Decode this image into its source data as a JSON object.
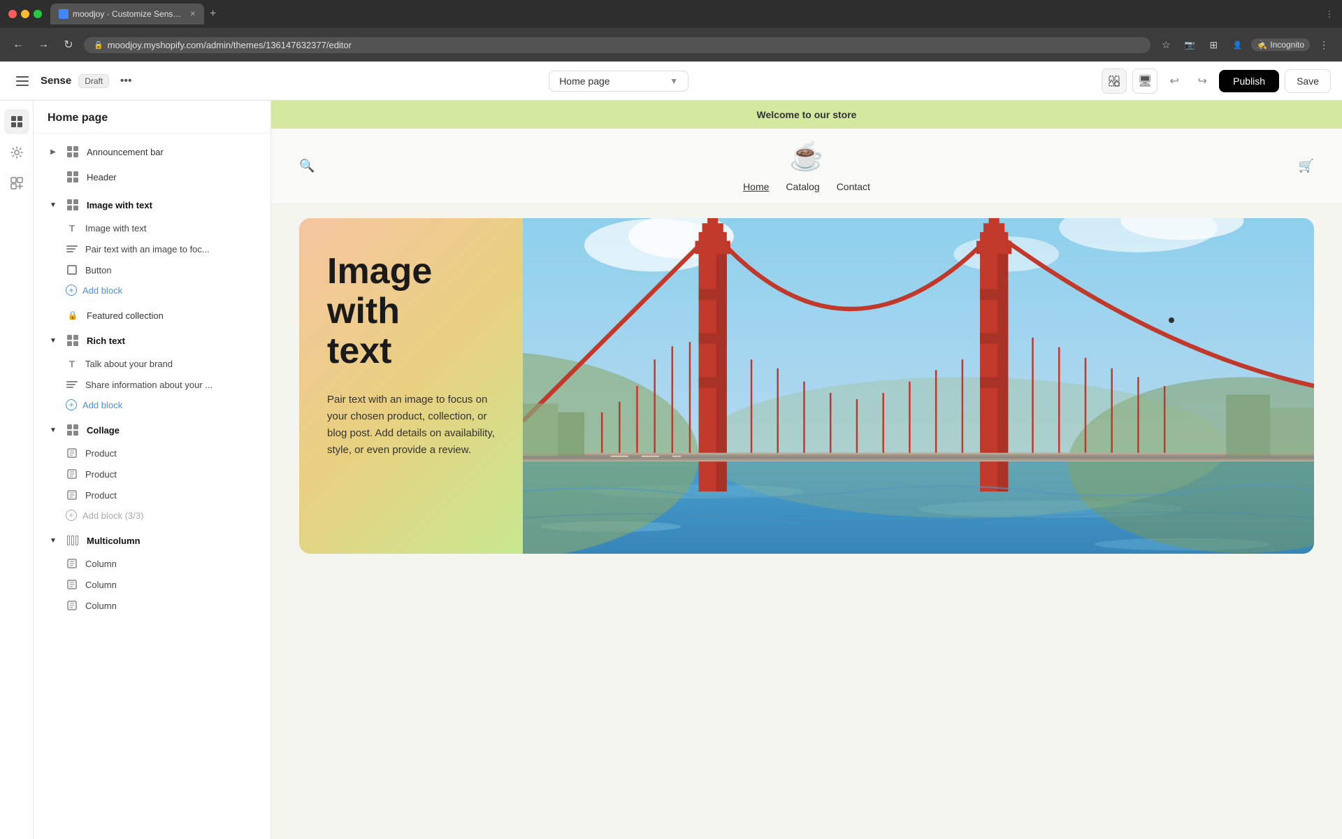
{
  "browser": {
    "tab_title": "moodjoy · Customize Sense · S",
    "url": "moodjoy.myshopify.com/admin/themes/136147632377/editor",
    "incognito_label": "Incognito"
  },
  "app": {
    "title": "Sense",
    "draft_label": "Draft",
    "page_selector": {
      "value": "Home page",
      "arrow": "▼"
    },
    "publish_label": "Publish",
    "save_label": "Save"
  },
  "sidebar": {
    "title": "Home page",
    "items": [
      {
        "id": "announcement-bar",
        "label": "Announcement bar",
        "expanded": false,
        "icon": "grid-icon",
        "indent": false
      },
      {
        "id": "header",
        "label": "Header",
        "expanded": false,
        "icon": "grid-icon",
        "indent": false
      },
      {
        "id": "image-with-text",
        "label": "Image with text",
        "expanded": true,
        "icon": "grid-icon",
        "indent": false
      },
      {
        "id": "image-with-text-block",
        "label": "Image with text",
        "icon": "t-icon",
        "indent": true
      },
      {
        "id": "pair-text-block",
        "label": "Pair text with an image to foc...",
        "icon": "lines-icon",
        "indent": true
      },
      {
        "id": "button-block",
        "label": "Button",
        "icon": "box-icon",
        "indent": true
      },
      {
        "id": "add-block-1",
        "label": "Add block",
        "icon": "plus-icon",
        "indent": true,
        "isAdd": true
      },
      {
        "id": "featured-collection",
        "label": "Featured collection",
        "expanded": false,
        "icon": "lock-icon",
        "indent": false
      },
      {
        "id": "rich-text",
        "label": "Rich text",
        "expanded": true,
        "icon": "grid-icon",
        "indent": false
      },
      {
        "id": "talk-about-brand",
        "label": "Talk about your brand",
        "icon": "t-icon",
        "indent": true
      },
      {
        "id": "share-information",
        "label": "Share information about your ...",
        "icon": "lines-icon",
        "indent": true
      },
      {
        "id": "add-block-2",
        "label": "Add block",
        "icon": "plus-icon",
        "indent": true,
        "isAdd": true
      },
      {
        "id": "collage",
        "label": "Collage",
        "expanded": true,
        "icon": "grid-icon",
        "indent": false
      },
      {
        "id": "product-1",
        "label": "Product",
        "icon": "box-outline-icon",
        "indent": true
      },
      {
        "id": "product-2",
        "label": "Product",
        "icon": "box-outline-icon",
        "indent": true
      },
      {
        "id": "product-3",
        "label": "Product",
        "icon": "box-outline-icon",
        "indent": true
      },
      {
        "id": "add-block-3",
        "label": "Add block (3/3)",
        "icon": "plus-icon",
        "indent": true,
        "isAdd": true,
        "disabled": true
      },
      {
        "id": "multicolumn",
        "label": "Multicolumn",
        "expanded": true,
        "icon": "cols-icon",
        "indent": false
      },
      {
        "id": "column-1",
        "label": "Column",
        "icon": "box-outline-icon",
        "indent": true
      },
      {
        "id": "column-2",
        "label": "Column",
        "icon": "box-outline-icon",
        "indent": true
      },
      {
        "id": "column-3",
        "label": "Column",
        "icon": "box-outline-icon",
        "indent": true
      }
    ]
  },
  "preview": {
    "announcement": "Welcome to our store",
    "nav": {
      "home": "Home",
      "catalog": "Catalog",
      "contact": "Contact"
    },
    "hero": {
      "title": "Image\nwith\ntext",
      "subtitle": "Pair text with an image to focus on your chosen product, collection, or blog post. Add details on availability, style, or even provide a review."
    }
  },
  "icons": {
    "back": "←",
    "forward": "→",
    "refresh": "↻",
    "search": "🔒",
    "star": "☆",
    "extensions": "⊞",
    "menu": "⋮",
    "monitor": "🖥",
    "undo": "↩",
    "redo": "↪",
    "sidebar": "☰",
    "more": "•••",
    "selection": "⬚",
    "plus": "+"
  }
}
